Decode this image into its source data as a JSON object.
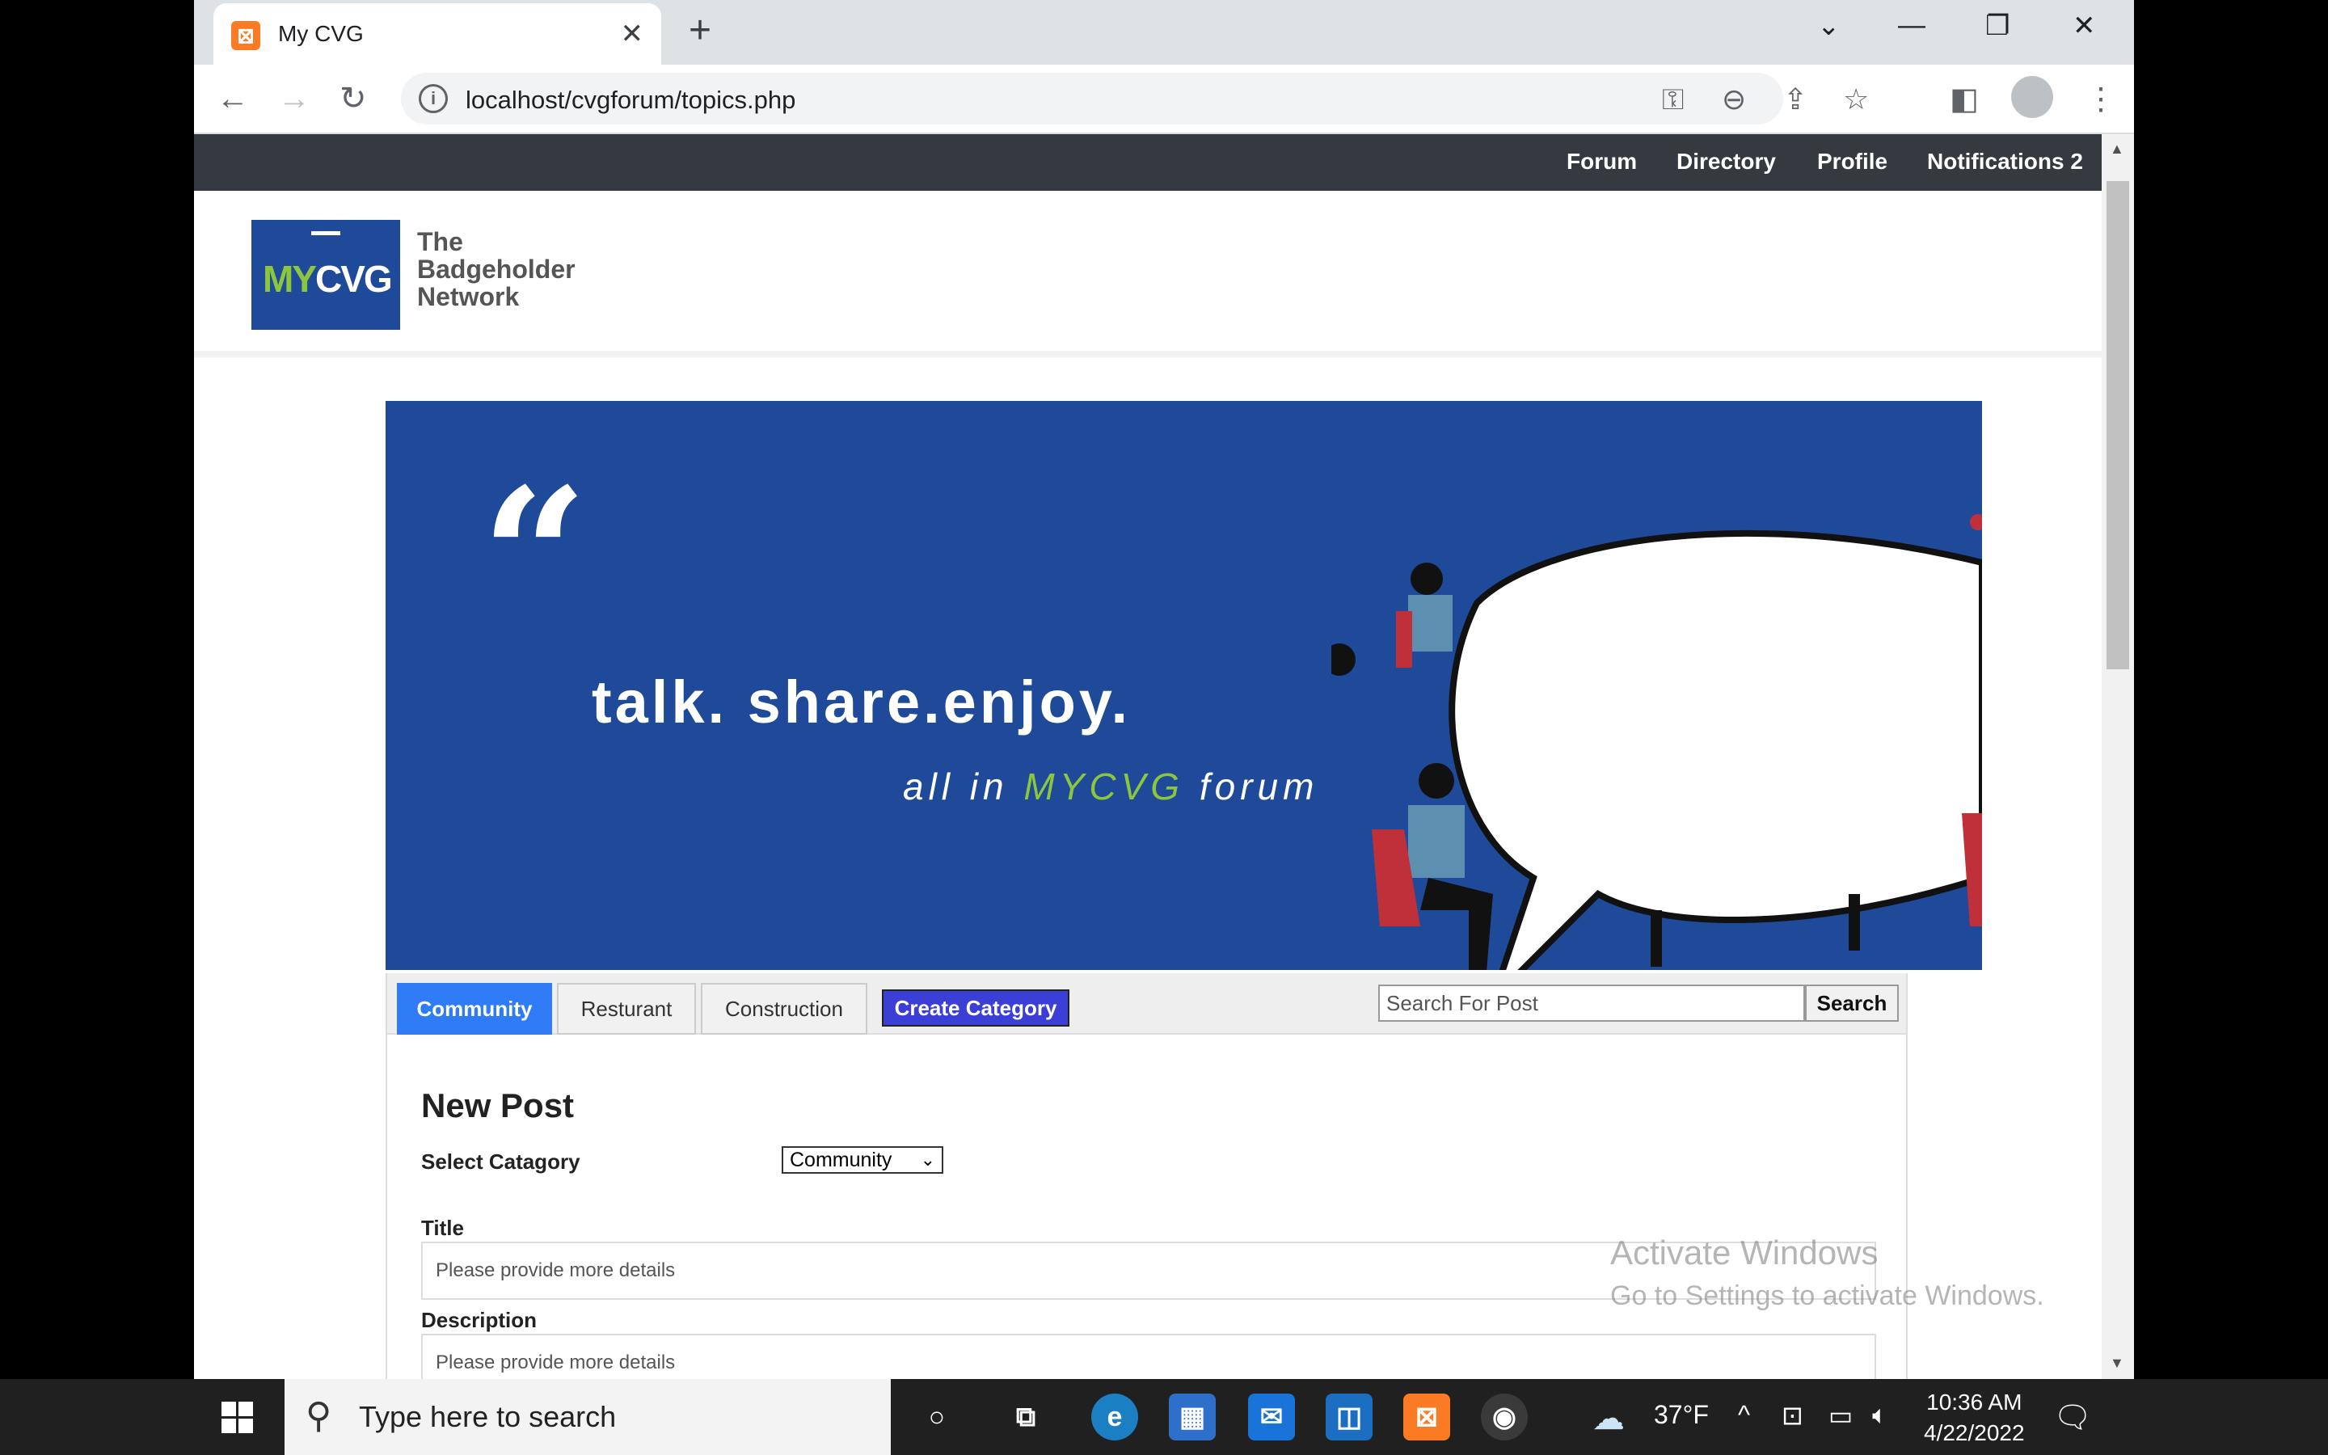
{
  "browser": {
    "tab_title": "My CVG",
    "url": "localhost/cvgforum/topics.php"
  },
  "topnav": [
    "Forum",
    "Directory",
    "Profile",
    "Notifications 2"
  ],
  "header": {
    "logo_my": "MY",
    "logo_c": "C",
    "logo_v": "V",
    "logo_g": "G",
    "tagline_1": "The",
    "tagline_2": "Badgeholder",
    "tagline_3": "Network"
  },
  "banner": {
    "quote_mark": "“",
    "main": "talk. share.enjoy.",
    "sub_prefix": "all in ",
    "sub_brand": "MYCVG",
    "sub_suffix": " forum"
  },
  "category_tabs": [
    "Community",
    "Resturant",
    "Construction"
  ],
  "create_category": "Create Category",
  "search": {
    "placeholder": "Search For Post",
    "button": "Search"
  },
  "new_post": {
    "heading": "New Post",
    "select_label": "Select Catagory",
    "selected_category": "Community",
    "title_label": "Title",
    "title_placeholder": "Please provide more details",
    "description_label": "Description",
    "description_placeholder": "Please provide more details"
  },
  "watermark": {
    "line1": "Activate Windows",
    "line2": "Go to Settings to activate Windows."
  },
  "taskbar": {
    "search_text": "Type here to search",
    "temperature": "37°F",
    "time": "10:36 AM",
    "date": "4/22/2022"
  }
}
